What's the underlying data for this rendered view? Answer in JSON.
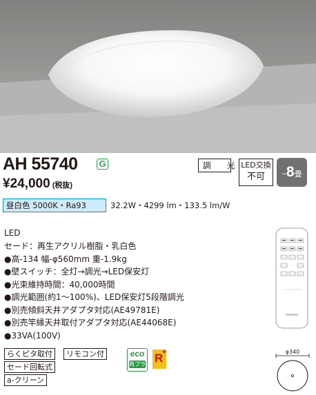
{
  "product": {
    "model": "AH 55740",
    "green_badge": "G",
    "price": "¥24,000",
    "tax_note": "(税抜)",
    "dimming_label": "調　光",
    "led_replace_line1": "LED交換",
    "led_replace_line2": "不可",
    "tatami_prefix": "~",
    "tatami_number": "8",
    "tatami_unit": "畳",
    "color_tag": "昼白色 5000K・Ra93",
    "spec_line": "32.2W・4299 lm・133.5 lm/W"
  },
  "details": {
    "title": "LED",
    "items": [
      "セード：再生アクリル樹脂・乳白色",
      "●高-134 幅-φ560mm 重-1.9kg",
      "●壁スイッチ：全灯→調光→LED保安灯",
      "●光束維持時間：40,000時間",
      "●調光範囲(約1～100%)、LED保安灯5段階調光",
      "●別売傾斜天井アダプタ対応(AE49781E)",
      "●別売竿縁天井取付アダプタ対応(AE44068E)",
      "●33VA(100V)"
    ]
  },
  "tags": {
    "rakupita": "らくピタ取付",
    "remote": "リモコン付",
    "shade_rotate": "セード回転式",
    "a_clean": "a-クリーン",
    "eco_top": "eco",
    "eco_bottom": "再プラ",
    "r_plus": "R",
    "r_plus_sup": "+"
  },
  "dimension": {
    "diameter": "φ340"
  },
  "colors": {
    "green": "#33a84a",
    "blue_border": "#0094d8",
    "blue_fill": "#cfeaf8",
    "tatami_bg": "#717171",
    "r_yellow": "#f3c21a",
    "r_red": "#c8101c"
  }
}
